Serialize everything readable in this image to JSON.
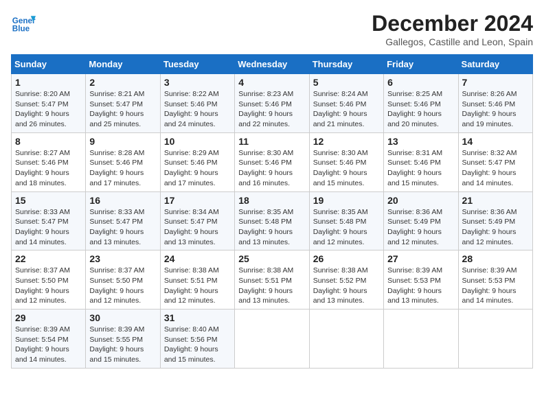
{
  "logo": {
    "line1": "General",
    "line2": "Blue"
  },
  "title": "December 2024",
  "subtitle": "Gallegos, Castille and Leon, Spain",
  "headers": [
    "Sunday",
    "Monday",
    "Tuesday",
    "Wednesday",
    "Thursday",
    "Friday",
    "Saturday"
  ],
  "weeks": [
    [
      {
        "day": "1",
        "sunrise": "8:20 AM",
        "sunset": "5:47 PM",
        "daylight": "9 hours and 26 minutes."
      },
      {
        "day": "2",
        "sunrise": "8:21 AM",
        "sunset": "5:47 PM",
        "daylight": "9 hours and 25 minutes."
      },
      {
        "day": "3",
        "sunrise": "8:22 AM",
        "sunset": "5:46 PM",
        "daylight": "9 hours and 24 minutes."
      },
      {
        "day": "4",
        "sunrise": "8:23 AM",
        "sunset": "5:46 PM",
        "daylight": "9 hours and 22 minutes."
      },
      {
        "day": "5",
        "sunrise": "8:24 AM",
        "sunset": "5:46 PM",
        "daylight": "9 hours and 21 minutes."
      },
      {
        "day": "6",
        "sunrise": "8:25 AM",
        "sunset": "5:46 PM",
        "daylight": "9 hours and 20 minutes."
      },
      {
        "day": "7",
        "sunrise": "8:26 AM",
        "sunset": "5:46 PM",
        "daylight": "9 hours and 19 minutes."
      }
    ],
    [
      {
        "day": "8",
        "sunrise": "8:27 AM",
        "sunset": "5:46 PM",
        "daylight": "9 hours and 18 minutes."
      },
      {
        "day": "9",
        "sunrise": "8:28 AM",
        "sunset": "5:46 PM",
        "daylight": "9 hours and 17 minutes."
      },
      {
        "day": "10",
        "sunrise": "8:29 AM",
        "sunset": "5:46 PM",
        "daylight": "9 hours and 17 minutes."
      },
      {
        "day": "11",
        "sunrise": "8:30 AM",
        "sunset": "5:46 PM",
        "daylight": "9 hours and 16 minutes."
      },
      {
        "day": "12",
        "sunrise": "8:30 AM",
        "sunset": "5:46 PM",
        "daylight": "9 hours and 15 minutes."
      },
      {
        "day": "13",
        "sunrise": "8:31 AM",
        "sunset": "5:46 PM",
        "daylight": "9 hours and 15 minutes."
      },
      {
        "day": "14",
        "sunrise": "8:32 AM",
        "sunset": "5:47 PM",
        "daylight": "9 hours and 14 minutes."
      }
    ],
    [
      {
        "day": "15",
        "sunrise": "8:33 AM",
        "sunset": "5:47 PM",
        "daylight": "9 hours and 14 minutes."
      },
      {
        "day": "16",
        "sunrise": "8:33 AM",
        "sunset": "5:47 PM",
        "daylight": "9 hours and 13 minutes."
      },
      {
        "day": "17",
        "sunrise": "8:34 AM",
        "sunset": "5:47 PM",
        "daylight": "9 hours and 13 minutes."
      },
      {
        "day": "18",
        "sunrise": "8:35 AM",
        "sunset": "5:48 PM",
        "daylight": "9 hours and 13 minutes."
      },
      {
        "day": "19",
        "sunrise": "8:35 AM",
        "sunset": "5:48 PM",
        "daylight": "9 hours and 12 minutes."
      },
      {
        "day": "20",
        "sunrise": "8:36 AM",
        "sunset": "5:49 PM",
        "daylight": "9 hours and 12 minutes."
      },
      {
        "day": "21",
        "sunrise": "8:36 AM",
        "sunset": "5:49 PM",
        "daylight": "9 hours and 12 minutes."
      }
    ],
    [
      {
        "day": "22",
        "sunrise": "8:37 AM",
        "sunset": "5:50 PM",
        "daylight": "9 hours and 12 minutes."
      },
      {
        "day": "23",
        "sunrise": "8:37 AM",
        "sunset": "5:50 PM",
        "daylight": "9 hours and 12 minutes."
      },
      {
        "day": "24",
        "sunrise": "8:38 AM",
        "sunset": "5:51 PM",
        "daylight": "9 hours and 12 minutes."
      },
      {
        "day": "25",
        "sunrise": "8:38 AM",
        "sunset": "5:51 PM",
        "daylight": "9 hours and 13 minutes."
      },
      {
        "day": "26",
        "sunrise": "8:38 AM",
        "sunset": "5:52 PM",
        "daylight": "9 hours and 13 minutes."
      },
      {
        "day": "27",
        "sunrise": "8:39 AM",
        "sunset": "5:53 PM",
        "daylight": "9 hours and 13 minutes."
      },
      {
        "day": "28",
        "sunrise": "8:39 AM",
        "sunset": "5:53 PM",
        "daylight": "9 hours and 14 minutes."
      }
    ],
    [
      {
        "day": "29",
        "sunrise": "8:39 AM",
        "sunset": "5:54 PM",
        "daylight": "9 hours and 14 minutes."
      },
      {
        "day": "30",
        "sunrise": "8:39 AM",
        "sunset": "5:55 PM",
        "daylight": "9 hours and 15 minutes."
      },
      {
        "day": "31",
        "sunrise": "8:40 AM",
        "sunset": "5:56 PM",
        "daylight": "9 hours and 15 minutes."
      },
      null,
      null,
      null,
      null
    ]
  ],
  "labels": {
    "sunrise": "Sunrise:",
    "sunset": "Sunset:",
    "daylight": "Daylight:"
  }
}
